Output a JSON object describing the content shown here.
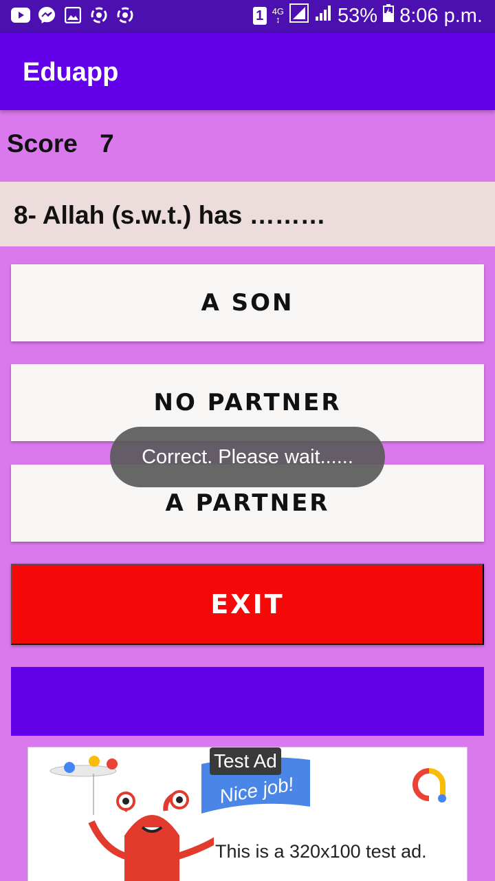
{
  "status_bar": {
    "sim_slot": "1",
    "network": "4G",
    "battery": "53%",
    "time": "8:06 p.m.",
    "icons": [
      "youtube-icon",
      "messenger-icon",
      "gallery-icon",
      "sync-icon",
      "sync-icon"
    ]
  },
  "app_bar": {
    "title": "Eduapp"
  },
  "score": {
    "label": "Score",
    "value": "7"
  },
  "question": {
    "text": "8- Allah (s.w.t.) has ………"
  },
  "options": [
    "A SON",
    "NO PARTNER",
    "A PARTNER"
  ],
  "exit": {
    "label": "EXIT"
  },
  "toast": {
    "text": "Correct. Please wait......"
  },
  "ad": {
    "label": "Test Ad",
    "flag_text": "Nice job!",
    "body": "This is a 320x100 test ad."
  },
  "colors": {
    "status_bar": "#4c0fb0",
    "app_bar": "#6200ea",
    "background": "#da79ed",
    "question_bg": "#ecdcdc",
    "option_bg": "#f8f5f5",
    "exit_bg": "#f50808"
  }
}
